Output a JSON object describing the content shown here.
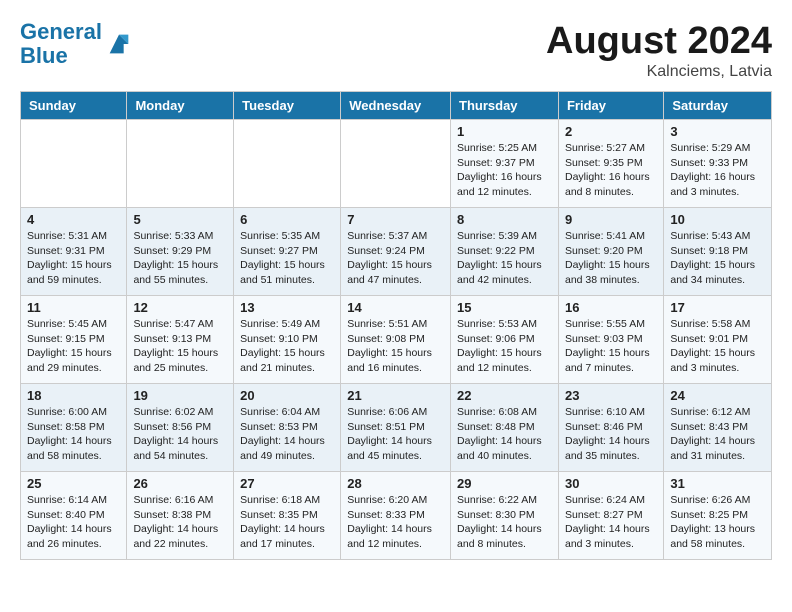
{
  "header": {
    "logo_line1": "General",
    "logo_line2": "Blue",
    "month": "August 2024",
    "location": "Kalnciems, Latvia"
  },
  "weekdays": [
    "Sunday",
    "Monday",
    "Tuesday",
    "Wednesday",
    "Thursday",
    "Friday",
    "Saturday"
  ],
  "weeks": [
    [
      {
        "day": "",
        "info": ""
      },
      {
        "day": "",
        "info": ""
      },
      {
        "day": "",
        "info": ""
      },
      {
        "day": "",
        "info": ""
      },
      {
        "day": "1",
        "info": "Sunrise: 5:25 AM\nSunset: 9:37 PM\nDaylight: 16 hours\nand 12 minutes."
      },
      {
        "day": "2",
        "info": "Sunrise: 5:27 AM\nSunset: 9:35 PM\nDaylight: 16 hours\nand 8 minutes."
      },
      {
        "day": "3",
        "info": "Sunrise: 5:29 AM\nSunset: 9:33 PM\nDaylight: 16 hours\nand 3 minutes."
      }
    ],
    [
      {
        "day": "4",
        "info": "Sunrise: 5:31 AM\nSunset: 9:31 PM\nDaylight: 15 hours\nand 59 minutes."
      },
      {
        "day": "5",
        "info": "Sunrise: 5:33 AM\nSunset: 9:29 PM\nDaylight: 15 hours\nand 55 minutes."
      },
      {
        "day": "6",
        "info": "Sunrise: 5:35 AM\nSunset: 9:27 PM\nDaylight: 15 hours\nand 51 minutes."
      },
      {
        "day": "7",
        "info": "Sunrise: 5:37 AM\nSunset: 9:24 PM\nDaylight: 15 hours\nand 47 minutes."
      },
      {
        "day": "8",
        "info": "Sunrise: 5:39 AM\nSunset: 9:22 PM\nDaylight: 15 hours\nand 42 minutes."
      },
      {
        "day": "9",
        "info": "Sunrise: 5:41 AM\nSunset: 9:20 PM\nDaylight: 15 hours\nand 38 minutes."
      },
      {
        "day": "10",
        "info": "Sunrise: 5:43 AM\nSunset: 9:18 PM\nDaylight: 15 hours\nand 34 minutes."
      }
    ],
    [
      {
        "day": "11",
        "info": "Sunrise: 5:45 AM\nSunset: 9:15 PM\nDaylight: 15 hours\nand 29 minutes."
      },
      {
        "day": "12",
        "info": "Sunrise: 5:47 AM\nSunset: 9:13 PM\nDaylight: 15 hours\nand 25 minutes."
      },
      {
        "day": "13",
        "info": "Sunrise: 5:49 AM\nSunset: 9:10 PM\nDaylight: 15 hours\nand 21 minutes."
      },
      {
        "day": "14",
        "info": "Sunrise: 5:51 AM\nSunset: 9:08 PM\nDaylight: 15 hours\nand 16 minutes."
      },
      {
        "day": "15",
        "info": "Sunrise: 5:53 AM\nSunset: 9:06 PM\nDaylight: 15 hours\nand 12 minutes."
      },
      {
        "day": "16",
        "info": "Sunrise: 5:55 AM\nSunset: 9:03 PM\nDaylight: 15 hours\nand 7 minutes."
      },
      {
        "day": "17",
        "info": "Sunrise: 5:58 AM\nSunset: 9:01 PM\nDaylight: 15 hours\nand 3 minutes."
      }
    ],
    [
      {
        "day": "18",
        "info": "Sunrise: 6:00 AM\nSunset: 8:58 PM\nDaylight: 14 hours\nand 58 minutes."
      },
      {
        "day": "19",
        "info": "Sunrise: 6:02 AM\nSunset: 8:56 PM\nDaylight: 14 hours\nand 54 minutes."
      },
      {
        "day": "20",
        "info": "Sunrise: 6:04 AM\nSunset: 8:53 PM\nDaylight: 14 hours\nand 49 minutes."
      },
      {
        "day": "21",
        "info": "Sunrise: 6:06 AM\nSunset: 8:51 PM\nDaylight: 14 hours\nand 45 minutes."
      },
      {
        "day": "22",
        "info": "Sunrise: 6:08 AM\nSunset: 8:48 PM\nDaylight: 14 hours\nand 40 minutes."
      },
      {
        "day": "23",
        "info": "Sunrise: 6:10 AM\nSunset: 8:46 PM\nDaylight: 14 hours\nand 35 minutes."
      },
      {
        "day": "24",
        "info": "Sunrise: 6:12 AM\nSunset: 8:43 PM\nDaylight: 14 hours\nand 31 minutes."
      }
    ],
    [
      {
        "day": "25",
        "info": "Sunrise: 6:14 AM\nSunset: 8:40 PM\nDaylight: 14 hours\nand 26 minutes."
      },
      {
        "day": "26",
        "info": "Sunrise: 6:16 AM\nSunset: 8:38 PM\nDaylight: 14 hours\nand 22 minutes."
      },
      {
        "day": "27",
        "info": "Sunrise: 6:18 AM\nSunset: 8:35 PM\nDaylight: 14 hours\nand 17 minutes."
      },
      {
        "day": "28",
        "info": "Sunrise: 6:20 AM\nSunset: 8:33 PM\nDaylight: 14 hours\nand 12 minutes."
      },
      {
        "day": "29",
        "info": "Sunrise: 6:22 AM\nSunset: 8:30 PM\nDaylight: 14 hours\nand 8 minutes."
      },
      {
        "day": "30",
        "info": "Sunrise: 6:24 AM\nSunset: 8:27 PM\nDaylight: 14 hours\nand 3 minutes."
      },
      {
        "day": "31",
        "info": "Sunrise: 6:26 AM\nSunset: 8:25 PM\nDaylight: 13 hours\nand 58 minutes."
      }
    ]
  ]
}
